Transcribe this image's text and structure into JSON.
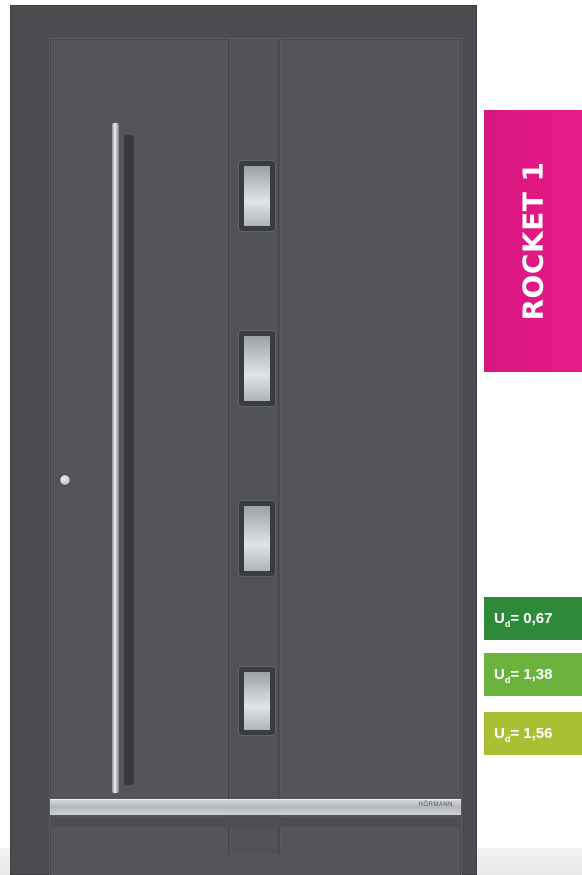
{
  "model": {
    "name": "ROCKET 1",
    "color": "#e61b8a"
  },
  "u_values": [
    {
      "symbol": "U",
      "subscript": "d",
      "value": "= 0,67",
      "color": "#2e8a3a"
    },
    {
      "symbol": "U",
      "subscript": "d",
      "value": "= 1,38",
      "color": "#6cb33e"
    },
    {
      "symbol": "U",
      "subscript": "d",
      "value": "= 1,56",
      "color": "#a8c034"
    }
  ],
  "door": {
    "color": "#535558",
    "window_count": 4,
    "brand_mark": "HÖRMANN"
  }
}
